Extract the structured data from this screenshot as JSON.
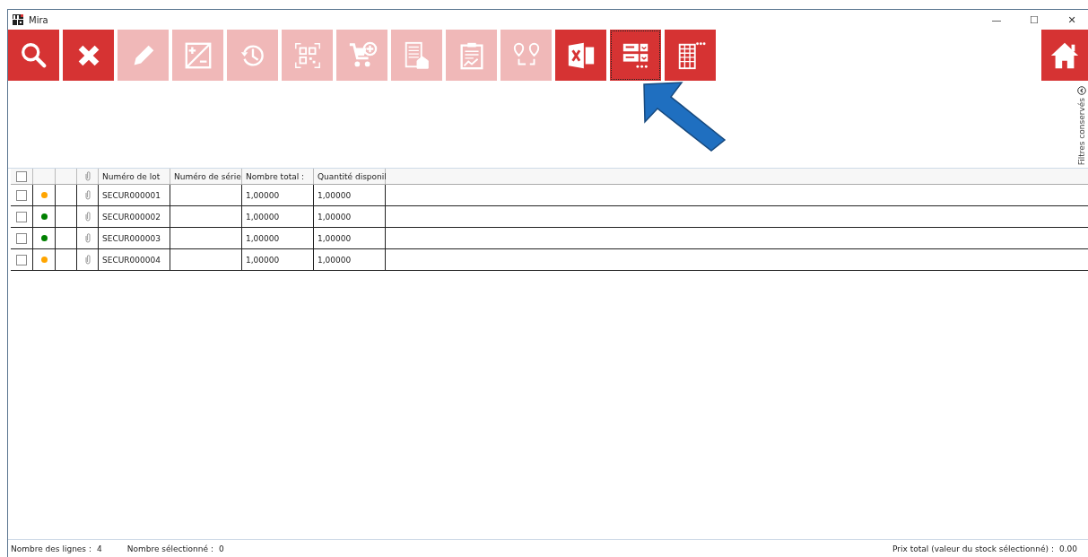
{
  "window": {
    "title": "Mira",
    "controls": [
      "—",
      "☐",
      "✕"
    ]
  },
  "toolbar": [
    {
      "kind": "search",
      "disabled": false,
      "focused": false
    },
    {
      "kind": "delete",
      "disabled": false,
      "focused": false
    },
    {
      "kind": "edit",
      "disabled": true,
      "focused": false
    },
    {
      "kind": "plusminus",
      "disabled": true,
      "focused": false
    },
    {
      "kind": "history",
      "disabled": true,
      "focused": false
    },
    {
      "kind": "qr",
      "disabled": true,
      "focused": false
    },
    {
      "kind": "cart",
      "disabled": true,
      "focused": false
    },
    {
      "kind": "document",
      "disabled": true,
      "focused": false
    },
    {
      "kind": "clipboard",
      "disabled": true,
      "focused": false
    },
    {
      "kind": "route",
      "disabled": true,
      "focused": false
    },
    {
      "kind": "excel",
      "disabled": false,
      "focused": false
    },
    {
      "kind": "columns",
      "disabled": false,
      "focused": true
    },
    {
      "kind": "table",
      "disabled": false,
      "focused": false
    }
  ],
  "home_button": {
    "kind": "home"
  },
  "filters_panel": {
    "label": "Filtres conservés"
  },
  "table": {
    "select_all": {
      "checked": false
    },
    "columns": [
      "Numéro de lot",
      "Numéro de série",
      "Nombre total :",
      "Quantité disponil"
    ],
    "rows": [
      {
        "checked": false,
        "color": "#ffa500",
        "lot": "SECUR000001",
        "total": "1,00000",
        "available": "1,00000"
      },
      {
        "checked": false,
        "color": "#008000",
        "lot": "SECUR000002",
        "total": "1,00000",
        "available": "1,00000"
      },
      {
        "checked": false,
        "color": "#008000",
        "lot": "SECUR000003",
        "total": "1,00000",
        "available": "1,00000"
      },
      {
        "checked": false,
        "color": "#ffa500",
        "lot": "SECUR000004",
        "total": "1,00000",
        "available": "1,00000"
      }
    ]
  },
  "status_bar": {
    "line_count_label": "Nombre des lignes :",
    "line_count": "4",
    "selected_label": "Nombre sélectionné :",
    "selected": "0",
    "total_label": "Prix total (valeur du stock sélectionné) :",
    "total": "0.00"
  }
}
